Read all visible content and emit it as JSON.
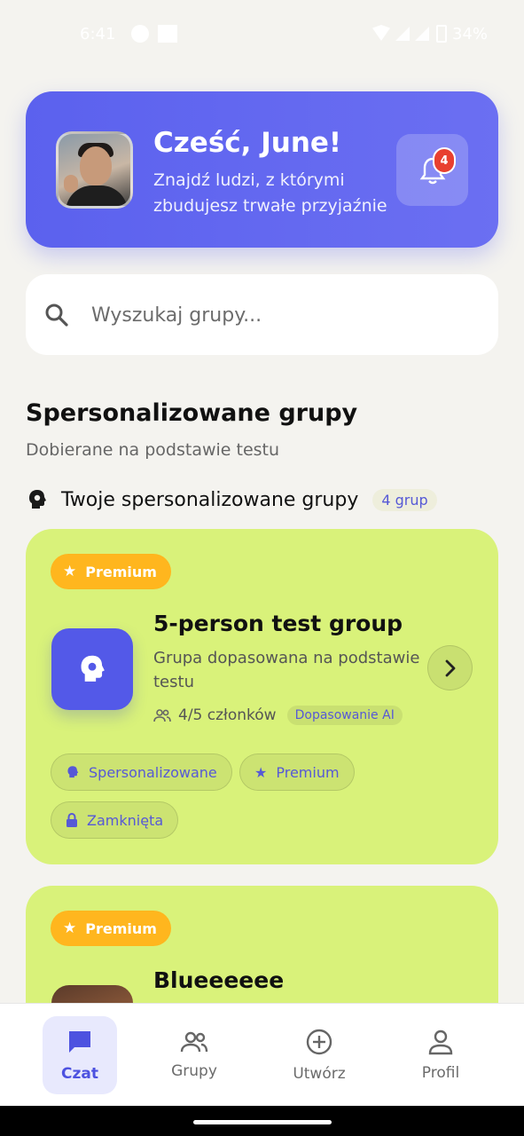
{
  "status_bar": {
    "time": "6:41",
    "battery": "34%"
  },
  "hero": {
    "title": "Cześć, June!",
    "subtitle": "Znajdź ludzi, z którymi zbudujesz trwałe przyjaźnie",
    "notification_count": "4"
  },
  "search": {
    "placeholder": "Wyszukaj grupy..."
  },
  "section": {
    "title": "Spersonalizowane grupy",
    "subtitle": "Dobierane na podstawie testu",
    "subhead": "Twoje spersonalizowane grupy",
    "count": "4 grup"
  },
  "groups": [
    {
      "badge": "Premium",
      "title": "5-person test group",
      "description": "Grupa dopasowana na podstawie testu",
      "members": "4/5 członków",
      "ai": "Dopasowanie AI",
      "tags": [
        "Spersonalizowane",
        "Premium",
        "Zamknięta"
      ]
    },
    {
      "badge": "Premium",
      "title": "Blueeeeee"
    }
  ],
  "nav": {
    "items": [
      {
        "label": "Czat",
        "icon": "chat-icon",
        "active": true
      },
      {
        "label": "Grupy",
        "icon": "people-icon"
      },
      {
        "label": "Utwórz",
        "icon": "plus-circle-icon"
      },
      {
        "label": "Profil",
        "icon": "person-icon"
      }
    ]
  },
  "colors": {
    "accent": "#5b61ee",
    "card": "#d9f27a",
    "premium": "#ffb61e",
    "badge": "#e8402f"
  }
}
